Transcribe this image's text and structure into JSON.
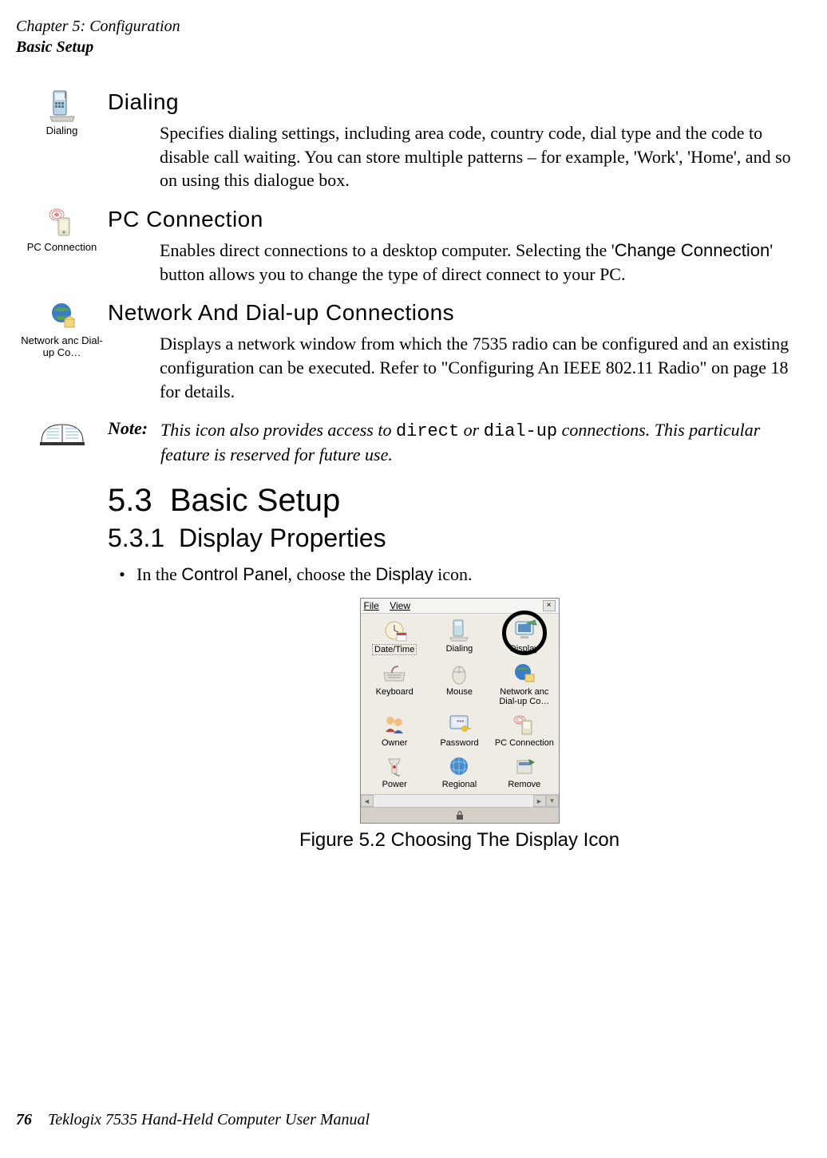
{
  "header": {
    "chapter": "Chapter 5: Configuration",
    "section": "Basic Setup"
  },
  "dialing": {
    "icon_label": "Dialing",
    "heading": "Dialing",
    "body": "Specifies dialing settings, including area code, country code, dial type and the code to disable call waiting. You can store multiple patterns – for example, 'Work', 'Home', and so on using this dialogue box."
  },
  "pcconn": {
    "icon_label": "PC Connection",
    "heading": "PC Connection",
    "body_pre": "Enables direct connections to a desktop computer. Selecting the '",
    "body_btn": "Change Connection",
    "body_post": "' button allows you to change the type of direct connect to your PC."
  },
  "network": {
    "icon_label": "Network anc Dial-up Co…",
    "heading": "Network And Dial-up Connections",
    "body": "Displays a network window from which the 7535 radio can be configured and an existing configuration can be executed. Refer to \"Configuring An IEEE 802.11 Radio\" on page 18 for details."
  },
  "note": {
    "label": "Note:",
    "pre": "This icon also provides access to ",
    "code1": "direct",
    "mid": " or ",
    "code2": "dial-up",
    "post": " connections. This particular feature is reserved for future use."
  },
  "h53": {
    "num": "5.3",
    "title": "Basic Setup"
  },
  "h531": {
    "num": "5.3.1",
    "title": "Display Properties"
  },
  "bullet": {
    "pre": "In the ",
    "b1": "Control Panel",
    "mid": ", choose the ",
    "b2": "Display",
    "post": " icon."
  },
  "cp": {
    "menu_file": "File",
    "menu_view": "View",
    "items": {
      "datetime": "Date/Time",
      "dialing": "Dialing",
      "display": "Display",
      "keyboard": "Keyboard",
      "mouse": "Mouse",
      "network": "Network anc Dial-up Co…",
      "owner": "Owner",
      "password": "Password",
      "pcconn": "PC Connection",
      "power": "Power",
      "regional": "Regional",
      "remove": "Remove"
    }
  },
  "figcaption": "Figure 5.2 Choosing The Display Icon",
  "footer": {
    "page": "76",
    "book": "Teklogix 7535 Hand-Held Computer User Manual"
  }
}
